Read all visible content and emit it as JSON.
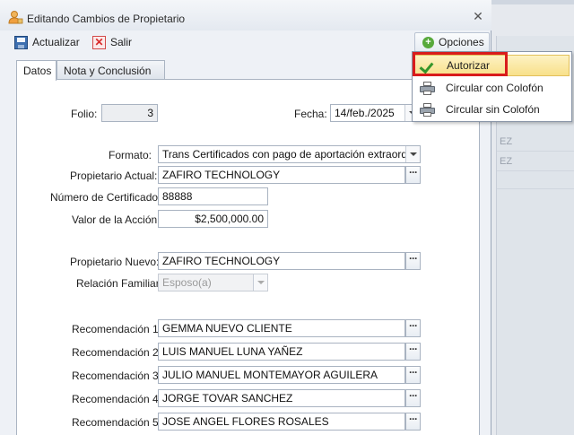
{
  "window": {
    "title": "Editando Cambios de Propietario",
    "icon": "user-edit-icon"
  },
  "toolbar": {
    "save_label": "Actualizar",
    "exit_label": "Salir",
    "options_label": "Opciones"
  },
  "tabs": [
    {
      "label": "Datos",
      "active": true
    },
    {
      "label": "Nota y Conclusión",
      "active": false
    }
  ],
  "form": {
    "folio_label": "Folio:",
    "folio_value": "3",
    "fecha_label": "Fecha:",
    "fecha_value": "14/feb./2025",
    "formato_label": "Formato:",
    "formato_value": "Trans Certificados con pago de aportación extraord",
    "prop_actual_label": "Propietario Actual:",
    "prop_actual_value": "ZAFIRO TECHNOLOGY",
    "num_cert_label": "Número de Certificado:",
    "num_cert_value": "88888",
    "valor_label": "Valor de la Acción:",
    "valor_value": "$2,500,000.00",
    "prop_nuevo_label": "Propietario Nuevo:",
    "prop_nuevo_value": "ZAFIRO TECHNOLOGY",
    "relacion_label": "Relación Familiar:",
    "relacion_value": "Esposo(a)",
    "recomendaciones": [
      {
        "label": "Recomendación 1:",
        "value": "GEMMA NUEVO CLIENTE"
      },
      {
        "label": "Recomendación 2:",
        "value": "LUIS MANUEL LUNA YAÑEZ"
      },
      {
        "label": "Recomendación 3:",
        "value": "JULIO MANUEL MONTEMAYOR AGUILERA"
      },
      {
        "label": "Recomendación 4:",
        "value": "JORGE TOVAR SANCHEZ"
      },
      {
        "label": "Recomendación 5:",
        "value": "JOSE ANGEL FLORES ROSALES"
      }
    ]
  },
  "menu": {
    "items": [
      {
        "label": "Autorizar",
        "icon": "check-icon",
        "highlighted": true
      },
      {
        "label": "Circular con Colofón",
        "icon": "printer-icon",
        "highlighted": false
      },
      {
        "label": "Circular sin Colofón",
        "icon": "printer-icon",
        "highlighted": false
      }
    ]
  },
  "background": {
    "rows": [
      "EZ",
      "EZ"
    ]
  },
  "colors": {
    "highlight_frame": "#d91c1c",
    "menu_highlight": "#f8e08a",
    "check": "#35952b"
  }
}
